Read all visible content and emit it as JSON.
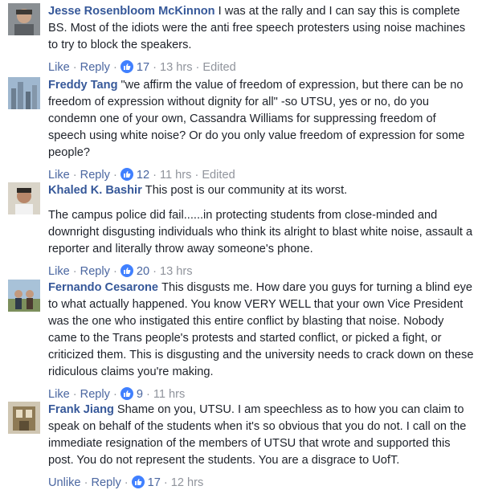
{
  "comments": [
    {
      "author": "Jesse Rosenbloom McKinnon",
      "paragraphs": [
        "I was at the rally and I can say this is complete BS. Most of the idiots were the anti free speech protesters using noise machines to try to block the speakers."
      ],
      "like_label": "Like",
      "reply_label": "Reply",
      "reactions": "17",
      "time": "13 hrs",
      "edited": "Edited"
    },
    {
      "author": "Freddy Tang",
      "paragraphs": [
        "\"we affirm the value of freedom of expression, but there can be no freedom of expression without dignity for all\" -so UTSU, yes or no, do you condemn one of your own, Cassandra Williams for suppressing freedom of speech using white noise? Or do you only value freedom of expression for some people?"
      ],
      "like_label": "Like",
      "reply_label": "Reply",
      "reactions": "12",
      "time": "11 hrs",
      "edited": "Edited"
    },
    {
      "author": "Khaled K. Bashir",
      "paragraphs": [
        "This post is our community at its worst.",
        "The campus police did fail......in protecting students from close-minded and downright disgusting individuals who think its alright to blast white noise, assault a reporter and literally throw away someone's phone."
      ],
      "like_label": "Like",
      "reply_label": "Reply",
      "reactions": "20",
      "time": "13 hrs",
      "edited": ""
    },
    {
      "author": "Fernando Cesarone",
      "paragraphs": [
        "This disgusts me. How dare you guys for turning a blind eye to what actually happened. You know VERY WELL that your own Vice President was the one who instigated this entire conflict by blasting that noise. Nobody came to the Trans people's protests and started conflict, or picked a fight, or criticized them. This is disgusting and the university needs to crack down on these ridiculous claims you're making."
      ],
      "like_label": "Like",
      "reply_label": "Reply",
      "reactions": "9",
      "time": "11 hrs",
      "edited": ""
    },
    {
      "author": "Frank Jiang",
      "paragraphs": [
        "Shame on you, UTSU. I am speechless as to how you can claim to speak on behalf of the students when it's so obvious that you do not. I call on the immediate resignation of the members of UTSU that wrote and supported this post. You do not represent the students. You are a disgrace to UofT."
      ],
      "like_label": "Unlike",
      "reply_label": "Reply",
      "reactions": "17",
      "time": "12 hrs",
      "edited": ""
    }
  ]
}
